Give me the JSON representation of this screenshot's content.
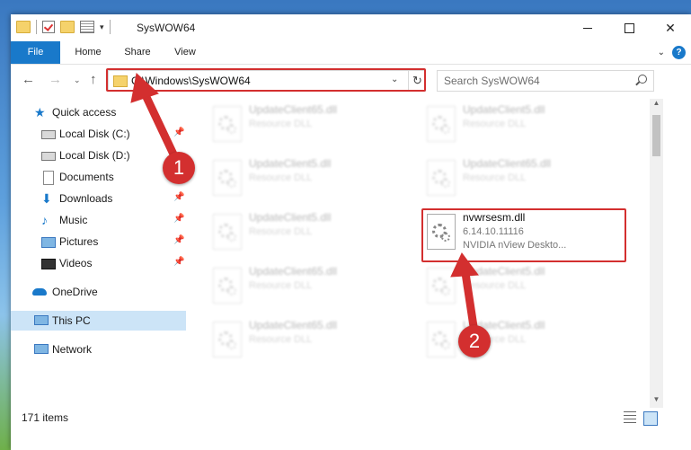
{
  "window": {
    "title": "SysWOW64",
    "controls": {
      "minimize": "—",
      "maximize": "☐",
      "close": "✕"
    }
  },
  "ribbon": {
    "tabs": [
      "File",
      "Home",
      "Share",
      "View"
    ]
  },
  "navigation": {
    "back": "←",
    "forward": "→",
    "recent": "⌄",
    "up": "↑",
    "address": "C:\\Windows\\SysWOW64",
    "refresh": "↻",
    "search_placeholder": "Search SysWOW64"
  },
  "sidebar": {
    "items": [
      {
        "label": "Quick access",
        "icon": "star-icon",
        "pinned": false
      },
      {
        "label": "Local Disk (C:)",
        "icon": "disk-icon",
        "pinned": true
      },
      {
        "label": "Local Disk (D:)",
        "icon": "disk-icon",
        "pinned": false
      },
      {
        "label": "Documents",
        "icon": "documents-icon",
        "pinned": true
      },
      {
        "label": "Downloads",
        "icon": "download-icon",
        "pinned": true
      },
      {
        "label": "Music",
        "icon": "music-icon",
        "pinned": true
      },
      {
        "label": "Pictures",
        "icon": "pictures-icon",
        "pinned": true
      },
      {
        "label": "Videos",
        "icon": "videos-icon",
        "pinned": true
      },
      {
        "label": "OneDrive",
        "icon": "cloud-icon",
        "pinned": false
      },
      {
        "label": "This PC",
        "icon": "pc-icon",
        "pinned": false,
        "selected": true
      },
      {
        "label": "Network",
        "icon": "network-icon",
        "pinned": false
      }
    ]
  },
  "files": [
    {
      "name": "UpdateClient65.dll",
      "type": "Resource DLL"
    },
    {
      "name": "UpdateClient5.dll",
      "type": "Resource DLL"
    },
    {
      "name": "UpdateClient5.dll",
      "type": "Resource DLL"
    },
    {
      "name": "UpdateClient65.dll",
      "type": "Resource DLL"
    },
    {
      "name": "UpdateClient5.dll",
      "type": "Resource DLL"
    },
    {
      "name": "nvwrsesm.dll",
      "version": "6.14.10.11116",
      "description": "NVIDIA nView Deskto...",
      "highlighted": true
    },
    {
      "name": "UpdateClient65.dll",
      "type": "Resource DLL"
    },
    {
      "name": "UpdateClient5.dll",
      "type": "Resource DLL"
    },
    {
      "name": "UpdateClient65.dll",
      "type": "Resource DLL"
    },
    {
      "name": "UpdateClient5.dll",
      "type": "Resource DLL"
    }
  ],
  "status": {
    "item_count": "171 items"
  },
  "callouts": [
    "1",
    "2"
  ],
  "colors": {
    "accent": "#1979ca",
    "highlight_red": "#d32f2f",
    "selected_bg": "#cce4f7"
  }
}
